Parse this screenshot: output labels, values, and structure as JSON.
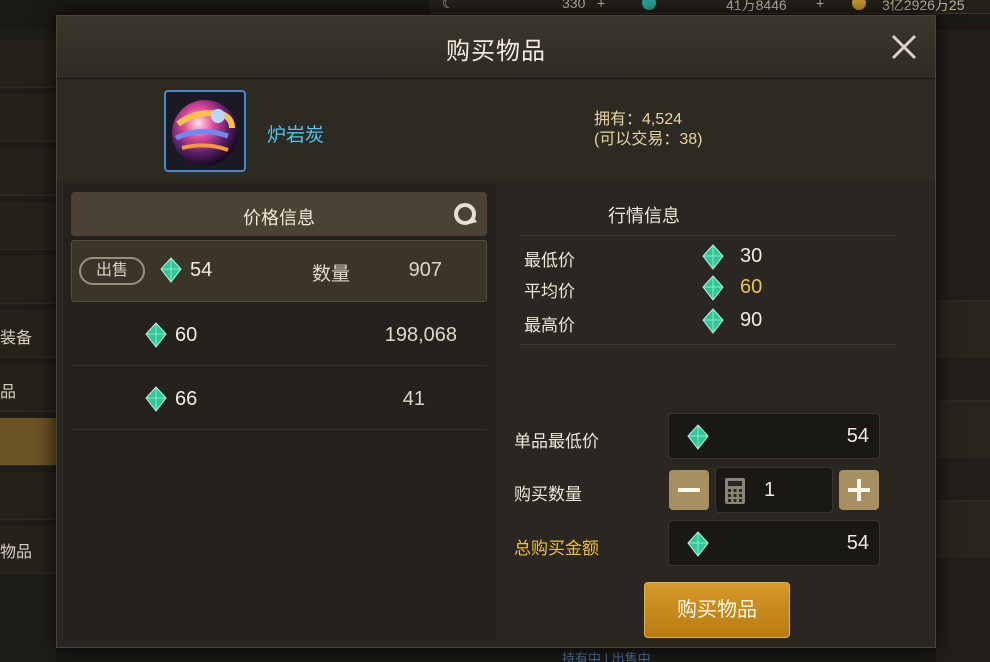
{
  "background": {
    "currencies": [
      "330",
      "41万8446",
      "3亿2926万25"
    ],
    "sidebar_labels": [
      "装备",
      "品",
      "物品"
    ],
    "bottom_text": "持有中 | 出售中"
  },
  "modal": {
    "title": "购买物品",
    "item": {
      "name": "炉岩炭",
      "owned": "拥有：4,524",
      "tradable": "(可以交易：38)"
    },
    "price_panel": {
      "title": "价格信息",
      "sell_label": "出售",
      "qty_label": "数量",
      "rows": [
        {
          "price": "54",
          "qty": "907"
        },
        {
          "price": "60",
          "qty": "198,068"
        },
        {
          "price": "66",
          "qty": "41"
        }
      ]
    },
    "market": {
      "title": "行情信息",
      "stats": [
        {
          "label": "最低价",
          "value": "30",
          "color": "#f2ecdf"
        },
        {
          "label": "平均价",
          "value": "60",
          "color": "#f0c24a"
        },
        {
          "label": "最高价",
          "value": "90",
          "color": "#f2ecdf"
        }
      ]
    },
    "form": {
      "unit_min_label": "单品最低价",
      "unit_min_value": "54",
      "qty_label": "购买数量",
      "qty_value": "1",
      "total_label": "总购买金额",
      "total_value": "54"
    },
    "buy_button": "购买物品"
  }
}
